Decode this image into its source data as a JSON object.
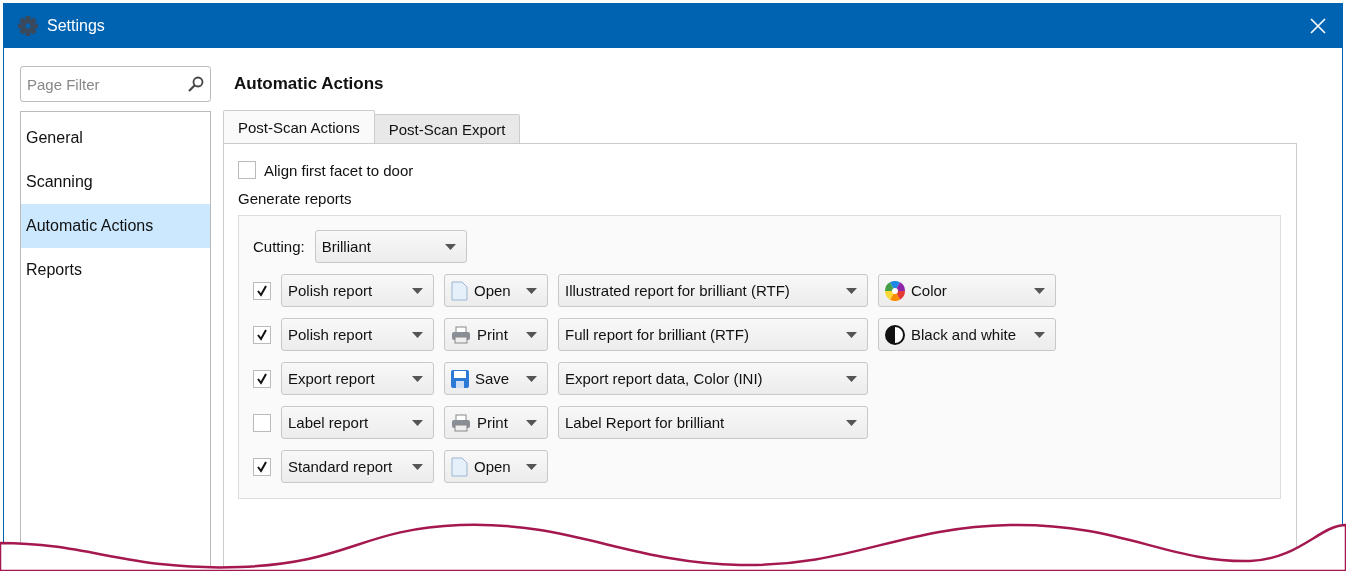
{
  "window": {
    "title": "Settings"
  },
  "sidebar": {
    "filter": {
      "placeholder": "Page Filter"
    },
    "items": [
      {
        "label": "General",
        "selected": false
      },
      {
        "label": "Scanning",
        "selected": false
      },
      {
        "label": "Automatic Actions",
        "selected": true
      },
      {
        "label": "Reports",
        "selected": false
      }
    ]
  },
  "page_title": "Automatic Actions",
  "tabs": [
    {
      "label": "Post-Scan Actions",
      "selected": true
    },
    {
      "label": "Post-Scan Export",
      "selected": false
    }
  ],
  "align_option": {
    "label": "Align first facet to door",
    "checked": false
  },
  "generate_reports": {
    "label": "Generate reports",
    "cutting": {
      "label": "Cutting:",
      "value": "Brilliant"
    },
    "rows": [
      {
        "checked": true,
        "report_type": "Polish report",
        "action": {
          "kind": "open",
          "label": "Open"
        },
        "template": "Illustrated report for brilliant (RTF)",
        "color_mode": {
          "kind": "color",
          "label": "Color"
        }
      },
      {
        "checked": true,
        "report_type": "Polish report",
        "action": {
          "kind": "print",
          "label": "Print"
        },
        "template": "Full report for brilliant (RTF)",
        "color_mode": {
          "kind": "bw",
          "label": "Black and white"
        }
      },
      {
        "checked": true,
        "report_type": "Export report",
        "action": {
          "kind": "save",
          "label": "Save"
        },
        "template": "Export report data, Color (INI)"
      },
      {
        "checked": false,
        "report_type": "Label report",
        "action": {
          "kind": "print",
          "label": "Print"
        },
        "template": "Label Report for brilliant"
      },
      {
        "checked": true,
        "report_type": "Standard report",
        "action": {
          "kind": "open",
          "label": "Open"
        }
      }
    ]
  }
}
